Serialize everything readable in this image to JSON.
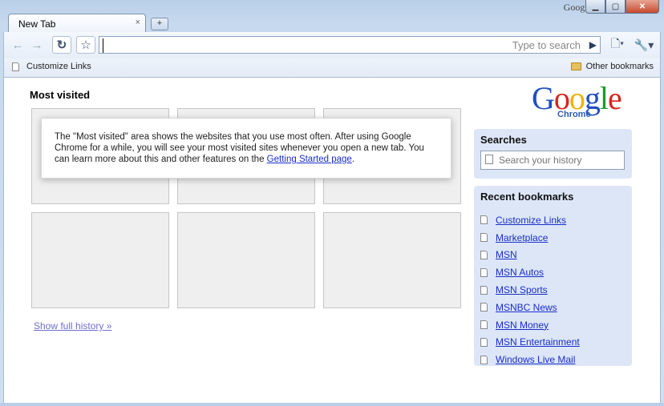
{
  "titlebar": {
    "brand": "Google",
    "buttons": {
      "minimize": "▁",
      "maximize": "▢",
      "close": "✕"
    }
  },
  "tab": {
    "title": "New Tab",
    "close": "×",
    "new_tab": "+"
  },
  "toolbar": {
    "back": "←",
    "forward": "→",
    "reload": "↻",
    "star": "☆",
    "omnibox_placeholder": "",
    "omnibox_hint": "Type to search",
    "go": "▶",
    "page_menu": "🗋▾",
    "tools_menu": "🔧▾"
  },
  "bookmarks_bar": {
    "left_item": "Customize Links",
    "right_item": "Other bookmarks"
  },
  "main": {
    "most_visited_title": "Most visited",
    "notice_text": "The \"Most visited\" area shows the websites that you use most often. After using Google Chrome for a while, you will see your most visited sites whenever you open a new tab. You can learn more about this and other features on the ",
    "notice_link": "Getting Started page",
    "notice_end": ".",
    "show_history": "Show full history »"
  },
  "logo": {
    "letters": [
      "G",
      "o",
      "o",
      "g",
      "l",
      "e"
    ],
    "colors": [
      "#1f4fc1",
      "#d8251d",
      "#f2b100",
      "#1f4fc1",
      "#1a9a2c",
      "#d8251d"
    ],
    "subtitle": "Chrome"
  },
  "searches": {
    "title": "Searches",
    "placeholder": "Search your history"
  },
  "recent_bookmarks": {
    "title": "Recent bookmarks",
    "items": [
      "Customize Links",
      "Marketplace",
      "MSN",
      "MSN Autos",
      "MSN Sports",
      "MSNBC News",
      "MSN Money",
      "MSN Entertainment",
      "Windows Live Mail"
    ]
  }
}
